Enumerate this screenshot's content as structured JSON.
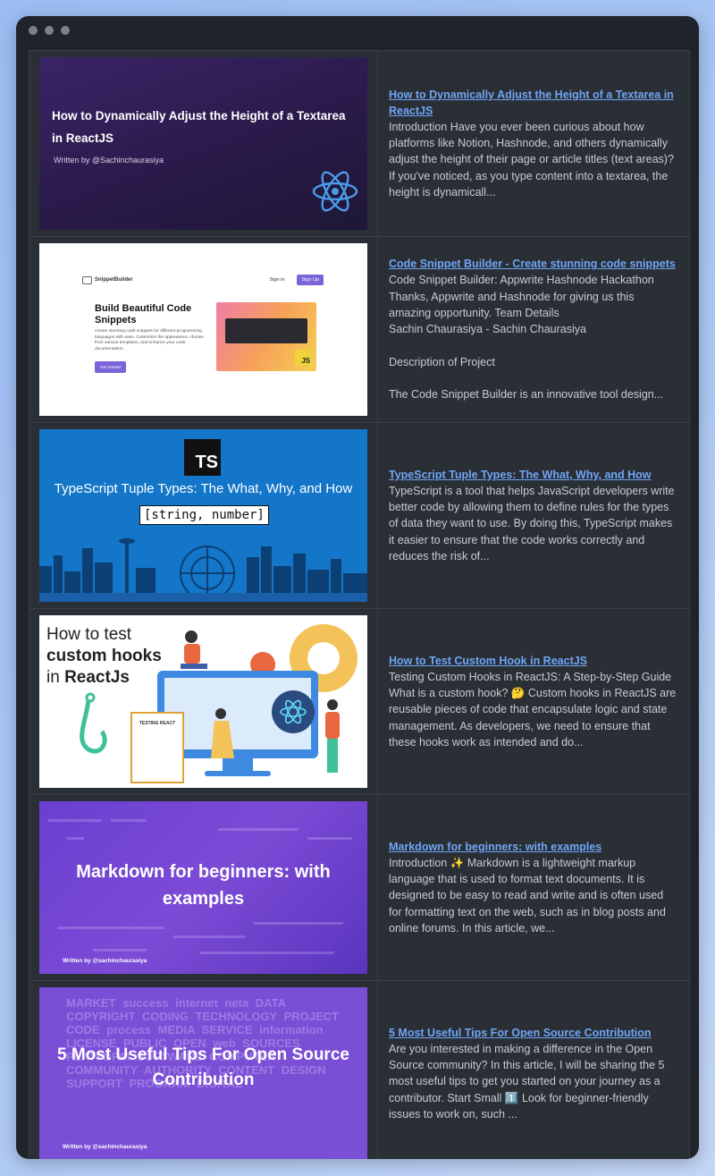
{
  "window": {
    "title_dots": [
      "close",
      "minimize",
      "maximize"
    ]
  },
  "posts": [
    {
      "thumb": {
        "heading": "How to Dynamically Adjust the Height of a Textarea in ReactJS",
        "byline": "Written by @Sachinchaurasiya",
        "icon": "react-icon"
      },
      "title": "How to Dynamically Adjust the Height of a Textarea in ReactJS",
      "excerpt": "Introduction Have you ever been curious about how platforms like Notion, Hashnode, and others dynamically adjust the height of their page or article titles (text areas)? If you've noticed, as you type content into a textarea, the height is dynamicall..."
    },
    {
      "thumb": {
        "brand": "SnippetBuilder",
        "signin": "Sign in",
        "signup": "Sign Up",
        "heading": "Build Beautiful Code Snippets",
        "desc": "Create stunning code snippets for different programming languages with ease. Customize the appearance, choose from various templates, and enhance your code documentation.",
        "cta": "Get Started",
        "badge": "JS"
      },
      "title": "Code Snippet Builder - Create stunning code snippets",
      "excerpt": "Code Snippet Builder: Appwrite Hashnode Hackathon\nThanks, Appwrite and Hashnode for giving us this amazing opportunity. Team Details\nSachin Chaurasiya - Sachin Chaurasiya\n\nDescription of Project\n\nThe Code Snippet Builder is an innovative tool design..."
    },
    {
      "thumb": {
        "badge": "TS",
        "heading": "TypeScript Tuple Types: The What, Why, and How",
        "code": "[string, number]"
      },
      "title": "TypeScript Tuple Types: The What, Why, and How",
      "excerpt": "TypeScript is a tool that helps JavaScript developers write better code by allowing them to define rules for the types of data they want to use. By doing this, TypeScript makes it easier to ensure that the code works correctly and reduces the risk of..."
    },
    {
      "thumb": {
        "line1": "How to test",
        "line2": "custom hooks",
        "line3_pre": "in ",
        "line3_bold": "ReactJs",
        "card": "TESTING REACT"
      },
      "title": "How to Test Custom Hook in ReactJS",
      "excerpt": "Testing Custom Hooks in ReactJS: A Step-by-Step Guide What is a custom hook? 🤔 Custom hooks in ReactJS are reusable pieces of code that encapsulate logic and state management. As developers, we need to ensure that these hooks work as intended and do..."
    },
    {
      "thumb": {
        "heading": "Markdown for beginners: with examples",
        "byline": "Written by @sachinchaurasiya"
      },
      "title": "Markdown for beginners: with examples",
      "excerpt": "Introduction ✨ Markdown is a lightweight markup language that is used to format text documents. It is designed to be easy to read and write and is often used for formatting text on the web, such as in blog posts and online forums. In this article, we..."
    },
    {
      "thumb": {
        "heading": "5 Most Useful Tips For Open Source Contribution",
        "byline": "Written by @sachinchaurasiya",
        "words": "MARKET success internet neta DATA COPYRIGHT CODING TECHNOLOGY PROJECT CODE process MEDIA SERVICE information LICENSE PUBLIC OPEN web SOURCES PLATFORM SOFTWARE COMPUTER COMMUNITY AUTHORITY CONTENT DESIGN SUPPORT PROGRAM DIGITAL"
      },
      "title": "5 Most Useful Tips For Open Source Contribution",
      "excerpt": "Are you interested in making a difference in the Open Source community? In this article, I will be sharing the 5 most useful tips to get you started on your journey as a contributor. Start Small 1️⃣ Look for beginner-friendly issues to work on, such ..."
    }
  ]
}
